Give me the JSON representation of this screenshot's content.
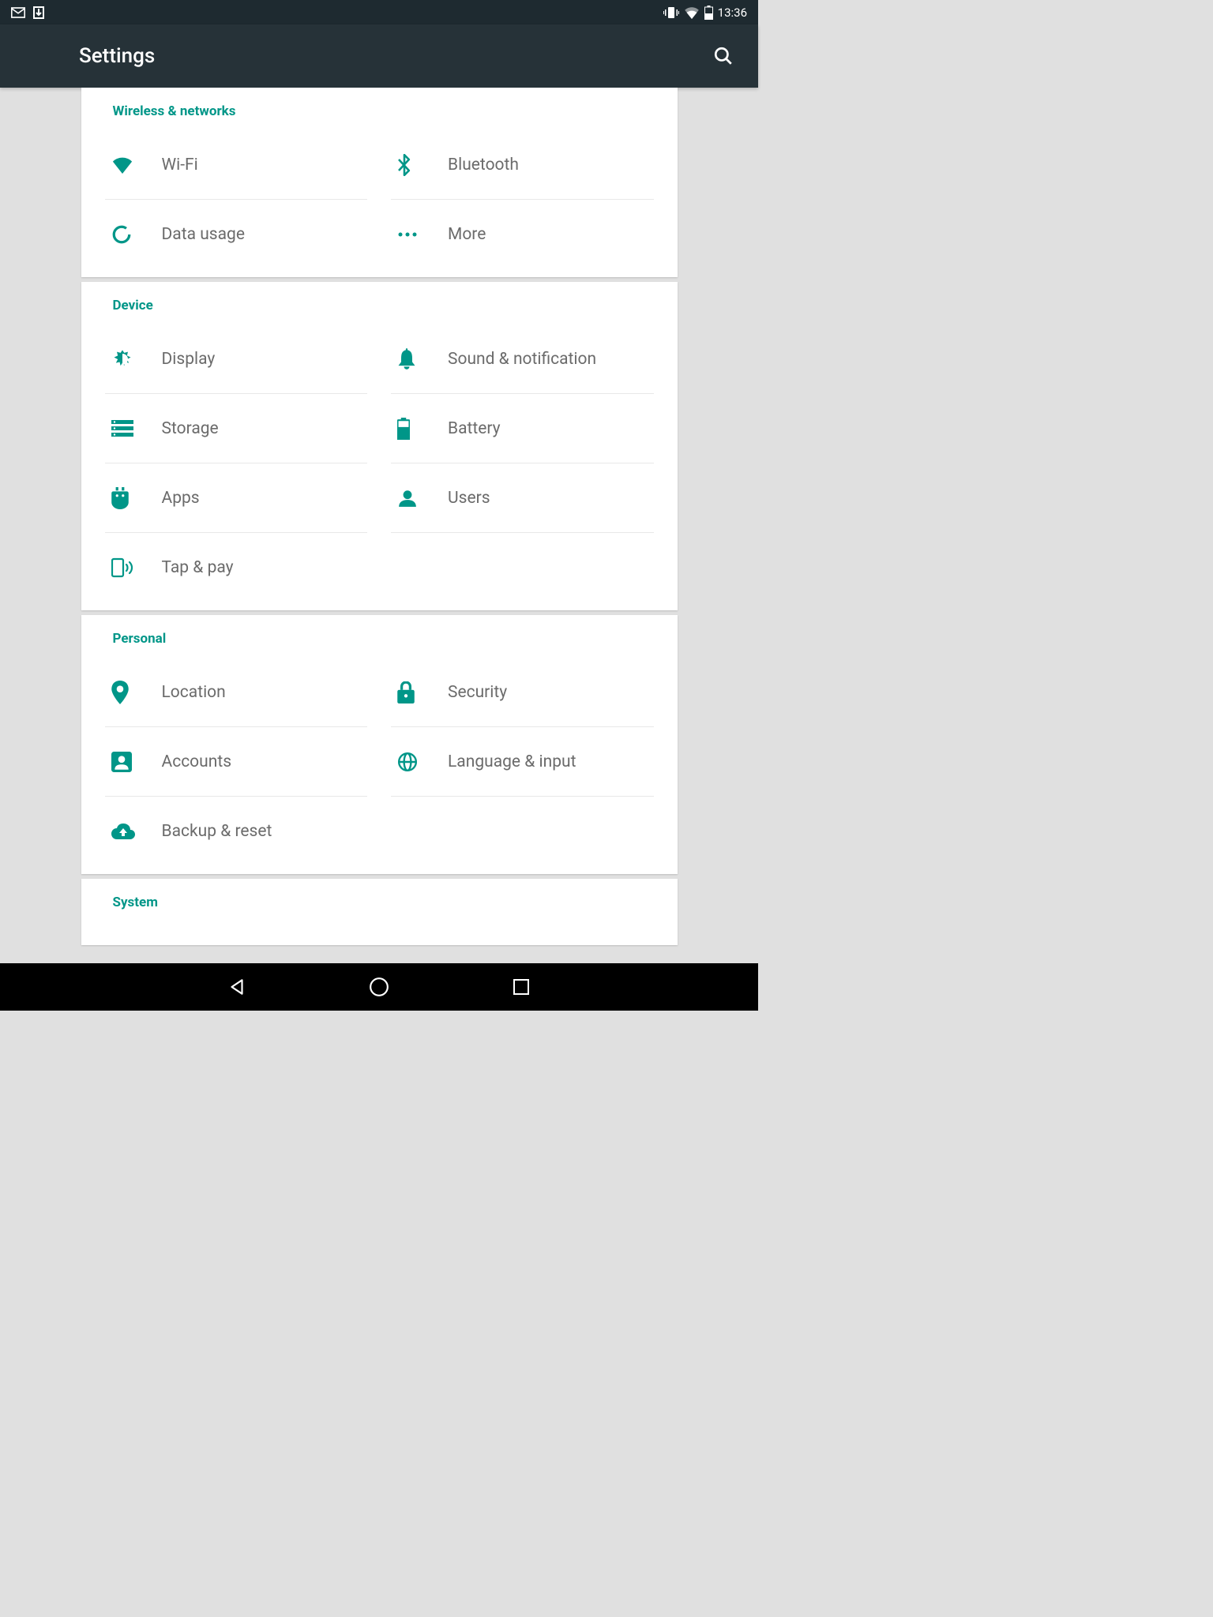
{
  "status_bar": {
    "time": "13:36"
  },
  "app_header": {
    "title": "Settings"
  },
  "sections": {
    "wireless": {
      "header": "Wireless & networks",
      "items": {
        "wifi": "Wi-Fi",
        "bluetooth": "Bluetooth",
        "data_usage": "Data usage",
        "more": "More"
      }
    },
    "device": {
      "header": "Device",
      "items": {
        "display": "Display",
        "sound": "Sound & notification",
        "storage": "Storage",
        "battery": "Battery",
        "apps": "Apps",
        "users": "Users",
        "tap_pay": "Tap & pay"
      }
    },
    "personal": {
      "header": "Personal",
      "items": {
        "location": "Location",
        "security": "Security",
        "accounts": "Accounts",
        "language": "Language & input",
        "backup": "Backup & reset"
      }
    },
    "system": {
      "header": "System"
    }
  },
  "colors": {
    "accent": "#009688",
    "app_bar": "#263238",
    "status_bar": "#1e2a30",
    "text_secondary": "#6b6b6b"
  }
}
